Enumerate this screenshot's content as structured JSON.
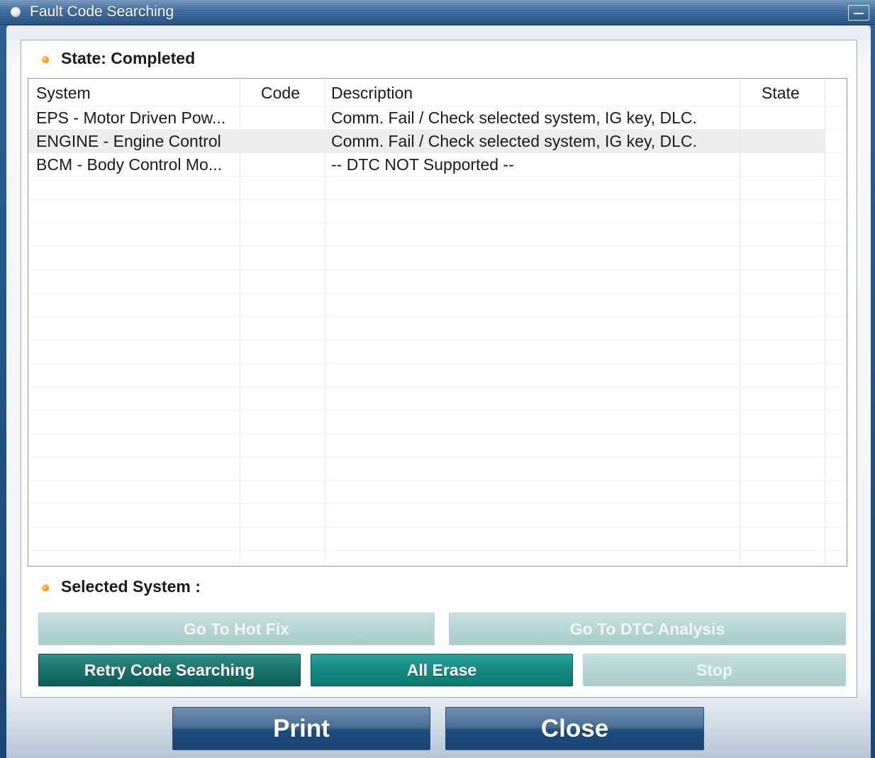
{
  "window": {
    "title": "Fault Code Searching"
  },
  "state_label": "State: Completed",
  "table": {
    "columns": [
      "System",
      "Code",
      "Description",
      "State"
    ],
    "rows": [
      {
        "system": "EPS - Motor Driven Pow...",
        "code": "",
        "description": "Comm. Fail / Check selected system, IG key, DLC.",
        "state": ""
      },
      {
        "system": "ENGINE - Engine Control",
        "code": "",
        "description": "Comm. Fail / Check selected system, IG key, DLC.",
        "state": ""
      },
      {
        "system": "BCM - Body Control Mo...",
        "code": "",
        "description": "-- DTC NOT Supported --",
        "state": ""
      }
    ],
    "selected_row": 1
  },
  "selected_system_label": "Selected System :",
  "buttons": {
    "hot_fix": "Go To Hot Fix",
    "dtc_analysis": "Go To DTC Analysis",
    "retry": "Retry Code Searching",
    "all_erase": "All Erase",
    "stop": "Stop",
    "print": "Print",
    "close": "Close"
  },
  "icons": {
    "title": "app-icon",
    "minimize": "minimize-icon",
    "bullet": "bullet-icon"
  },
  "colors": {
    "bullet": "#f59c1a",
    "teal_button": "#138a82",
    "dark_teal_button": "#0c5c56",
    "disabled_button": "#b6d6d3",
    "window_blue": "#1c4675"
  }
}
